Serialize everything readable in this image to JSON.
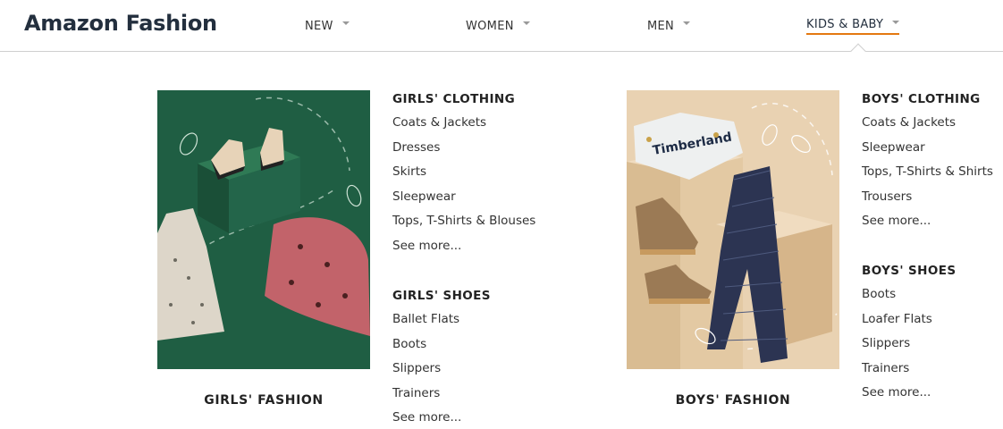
{
  "header": {
    "logo": "Amazon Fashion",
    "nav": [
      {
        "label": "NEW"
      },
      {
        "label": "WOMEN"
      },
      {
        "label": "MEN"
      },
      {
        "label": "KIDS & BABY"
      }
    ]
  },
  "girls": {
    "caption": "GIRLS' FASHION",
    "clothing": {
      "heading": "GIRLS' CLOTHING",
      "links": [
        "Coats & Jackets",
        "Dresses",
        "Skirts",
        "Sleepwear",
        "Tops, T-Shirts & Blouses",
        "See more..."
      ]
    },
    "shoes": {
      "heading": "GIRLS' SHOES",
      "links": [
        "Ballet Flats",
        "Boots",
        "Slippers",
        "Trainers",
        "See more..."
      ]
    }
  },
  "boys": {
    "caption": "BOYS' FASHION",
    "clothing": {
      "heading": "BOYS' CLOTHING",
      "links": [
        "Coats & Jackets",
        "Sleepwear",
        "Tops, T-Shirts & Shirts",
        "Trousers",
        "See more..."
      ]
    },
    "shoes": {
      "heading": "BOYS' SHOES",
      "links": [
        "Boots",
        "Loafer Flats",
        "Slippers",
        "Trainers",
        "See more..."
      ]
    }
  },
  "colors": {
    "accent": "#e47911",
    "logo": "#232f3e",
    "girls_bg": "#1f5e43",
    "boys_bg": "#e9d2b2"
  }
}
